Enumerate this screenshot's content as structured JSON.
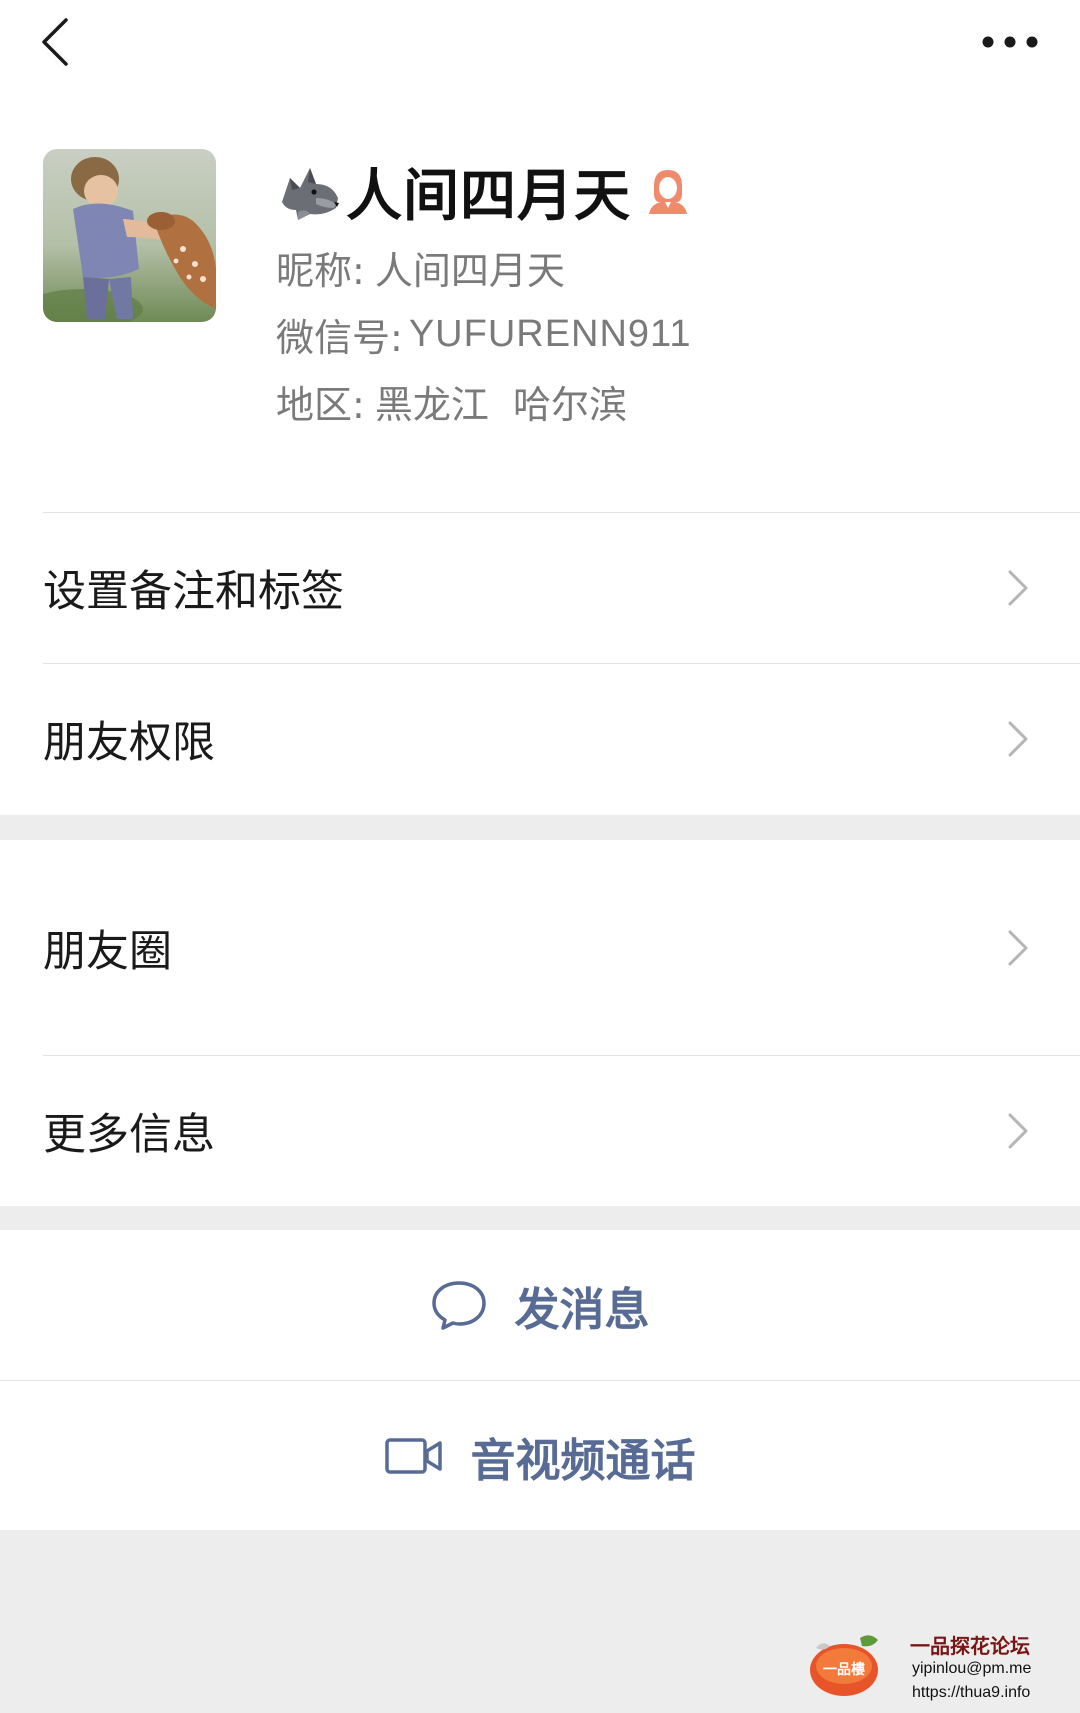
{
  "header": {
    "back_icon": "chevron-left-icon",
    "more_icon": "more-horizontal-icon"
  },
  "profile": {
    "avatar": "avatar-photo-child-with-fawn",
    "name_emoji": "wolf-emoji",
    "display_name": "人间四月天",
    "gender_icon": "female-icon",
    "gender_color": "#f08a6c",
    "nickname_label": "昵称:",
    "nickname_value": "人间四月天",
    "wechat_id_label": "微信号:",
    "wechat_id_value": "YUFURENN911",
    "region_label": "地区:",
    "region_value": "黑龙江  哈尔滨"
  },
  "menu": {
    "remark_tags": "设置备注和标签",
    "friend_permissions": "朋友权限",
    "moments": "朋友圈",
    "more_info": "更多信息"
  },
  "actions": {
    "send_message": "发消息",
    "av_call": "音视频通话",
    "accent_color": "#576b95"
  },
  "watermark": {
    "logo_text": "一品楼",
    "title": "一品探花论坛",
    "email": "yipinlou@pm.me",
    "url": "https://thua9.info"
  }
}
